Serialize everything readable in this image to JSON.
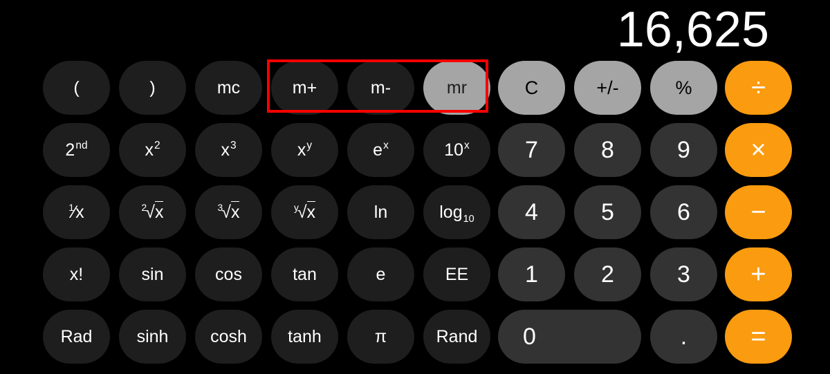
{
  "display": {
    "value": "16,625"
  },
  "annotation": {
    "color": "#ff0000",
    "targets": [
      "m+",
      "m-",
      "mr"
    ]
  },
  "colors": {
    "background": "#000000",
    "function_key": "#1e1e1e",
    "number_key": "#333333",
    "gray_key": "#a5a5a5",
    "orange_key": "#fb9b10",
    "highlight_key": "#a5a5a5",
    "text_light": "#ffffff",
    "text_dark": "#000000",
    "annotation": "#ff0000"
  },
  "keypad": {
    "rows": [
      {
        "keys": [
          {
            "label": "(",
            "name": "open-paren-key",
            "style": "func"
          },
          {
            "label": ")",
            "name": "close-paren-key",
            "style": "func"
          },
          {
            "label": "mc",
            "name": "memory-clear-key",
            "style": "func"
          },
          {
            "label": "m+",
            "name": "memory-add-key",
            "style": "func"
          },
          {
            "label": "m-",
            "name": "memory-subtract-key",
            "style": "func"
          },
          {
            "label": "mr",
            "name": "memory-recall-key",
            "style": "highlighted"
          },
          {
            "label": "C",
            "name": "clear-key",
            "style": "gray"
          },
          {
            "label": "+/-",
            "name": "sign-toggle-key",
            "style": "gray"
          },
          {
            "label": "%",
            "name": "percent-key",
            "style": "gray"
          },
          {
            "label": "÷",
            "name": "divide-key",
            "style": "orange"
          }
        ]
      },
      {
        "keys": [
          {
            "label": "2nd",
            "name": "second-function-key",
            "style": "func"
          },
          {
            "label": "x²",
            "name": "x-squared-key",
            "style": "func"
          },
          {
            "label": "x³",
            "name": "x-cubed-key",
            "style": "func"
          },
          {
            "label": "xʸ",
            "name": "x-power-y-key",
            "style": "func"
          },
          {
            "label": "eˣ",
            "name": "e-power-x-key",
            "style": "func"
          },
          {
            "label": "10ˣ",
            "name": "ten-power-x-key",
            "style": "func"
          },
          {
            "label": "7",
            "name": "digit-7-key",
            "style": "num"
          },
          {
            "label": "8",
            "name": "digit-8-key",
            "style": "num"
          },
          {
            "label": "9",
            "name": "digit-9-key",
            "style": "num"
          },
          {
            "label": "×",
            "name": "multiply-key",
            "style": "orange"
          }
        ]
      },
      {
        "keys": [
          {
            "label": "¹⁄x",
            "name": "reciprocal-key",
            "style": "func"
          },
          {
            "label": "²√x",
            "name": "square-root-key",
            "style": "func"
          },
          {
            "label": "³√x",
            "name": "cube-root-key",
            "style": "func"
          },
          {
            "label": "ʸ√x",
            "name": "y-root-key",
            "style": "func"
          },
          {
            "label": "ln",
            "name": "natural-log-key",
            "style": "func"
          },
          {
            "label": "log₁₀",
            "name": "log-base-10-key",
            "style": "func"
          },
          {
            "label": "4",
            "name": "digit-4-key",
            "style": "num"
          },
          {
            "label": "5",
            "name": "digit-5-key",
            "style": "num"
          },
          {
            "label": "6",
            "name": "digit-6-key",
            "style": "num"
          },
          {
            "label": "−",
            "name": "subtract-key",
            "style": "orange"
          }
        ]
      },
      {
        "keys": [
          {
            "label": "x!",
            "name": "factorial-key",
            "style": "func"
          },
          {
            "label": "sin",
            "name": "sine-key",
            "style": "func"
          },
          {
            "label": "cos",
            "name": "cosine-key",
            "style": "func"
          },
          {
            "label": "tan",
            "name": "tangent-key",
            "style": "func"
          },
          {
            "label": "e",
            "name": "euler-number-key",
            "style": "func"
          },
          {
            "label": "EE",
            "name": "exponent-key",
            "style": "func"
          },
          {
            "label": "1",
            "name": "digit-1-key",
            "style": "num"
          },
          {
            "label": "2",
            "name": "digit-2-key",
            "style": "num"
          },
          {
            "label": "3",
            "name": "digit-3-key",
            "style": "num"
          },
          {
            "label": "+",
            "name": "add-key",
            "style": "orange"
          }
        ]
      },
      {
        "keys": [
          {
            "label": "Rad",
            "name": "radian-mode-key",
            "style": "func"
          },
          {
            "label": "sinh",
            "name": "hyperbolic-sine-key",
            "style": "func"
          },
          {
            "label": "cosh",
            "name": "hyperbolic-cosine-key",
            "style": "func"
          },
          {
            "label": "tanh",
            "name": "hyperbolic-tangent-key",
            "style": "func"
          },
          {
            "label": "π",
            "name": "pi-key",
            "style": "func"
          },
          {
            "label": "Rand",
            "name": "random-key",
            "style": "func"
          },
          {
            "label": "0",
            "name": "digit-0-key",
            "style": "num-wide"
          },
          {
            "label": ".",
            "name": "decimal-point-key",
            "style": "num"
          },
          {
            "label": "=",
            "name": "equals-key",
            "style": "orange"
          }
        ]
      }
    ]
  }
}
